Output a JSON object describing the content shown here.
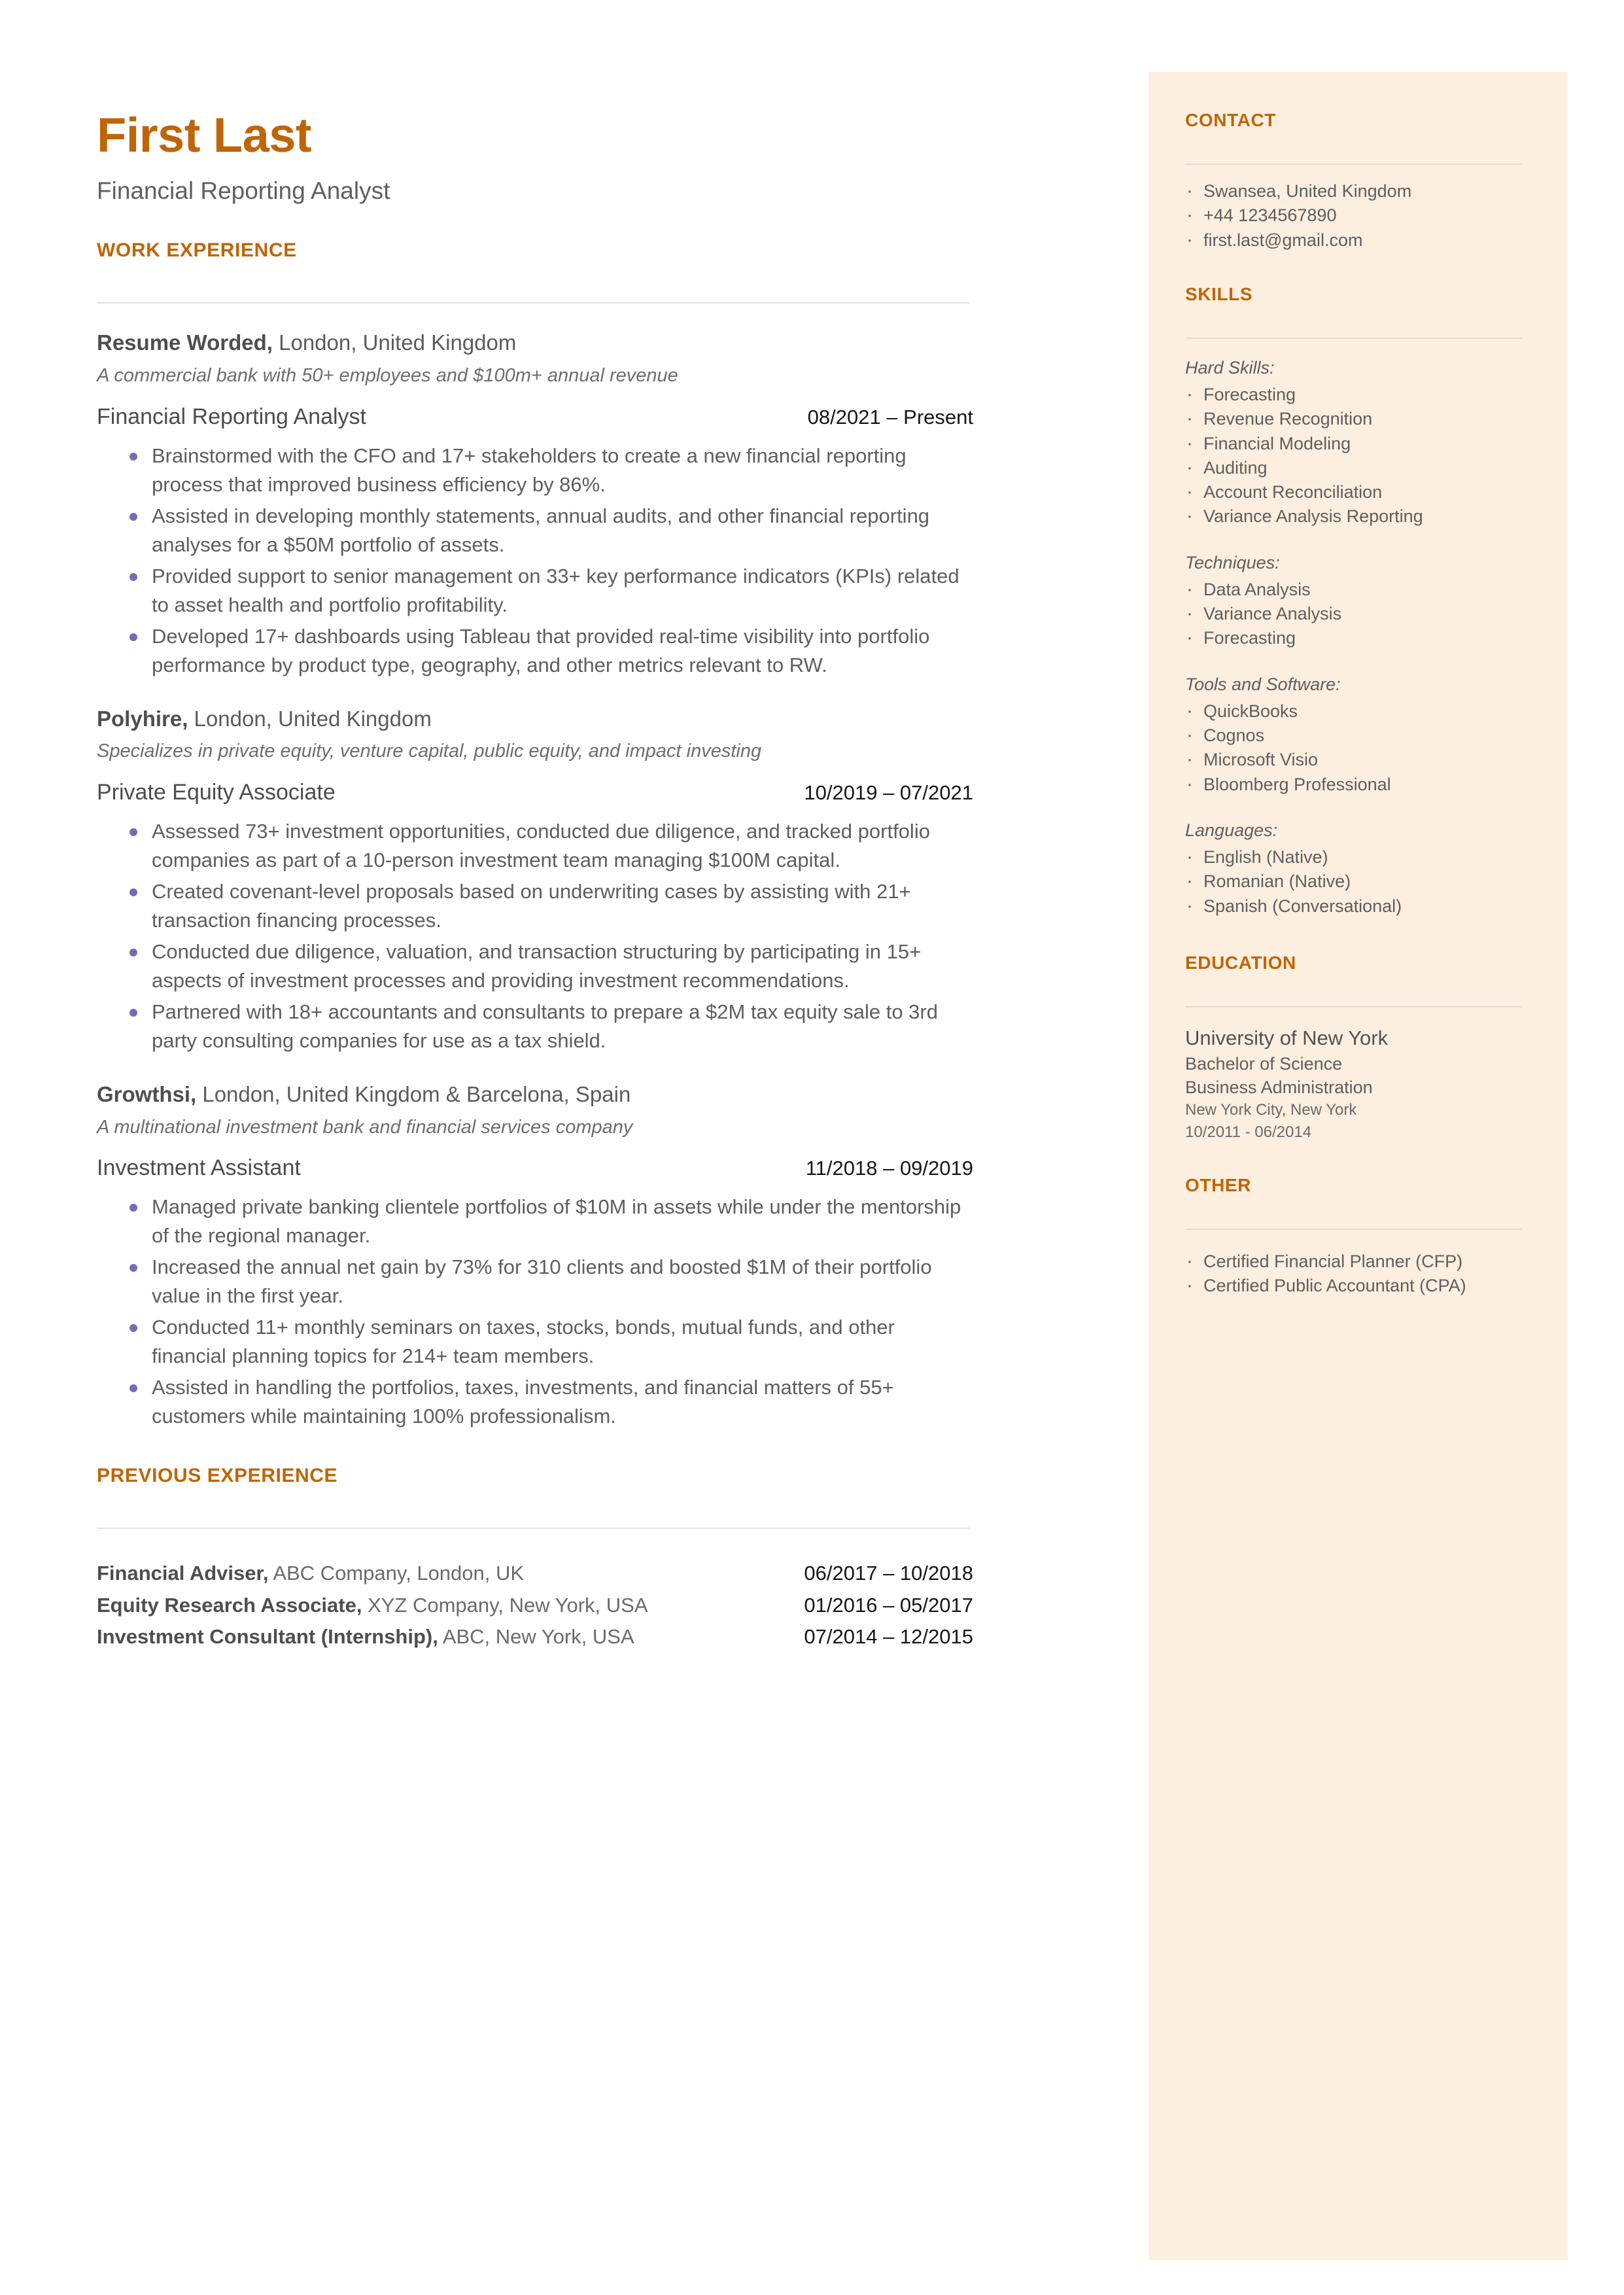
{
  "colors": {
    "accent": "#BF6507",
    "sidebar_bg": "#FDEFDF",
    "bullet": "#7B68B5",
    "body_text": "#5E5E5E",
    "date_text": "#161616"
  },
  "header": {
    "name": "First Last",
    "title": "Financial Reporting Analyst"
  },
  "work_experience": {
    "section_title": "WORK EXPERIENCE",
    "jobs": [
      {
        "company": "Resume Worded,",
        "location": " London, United Kingdom",
        "description": "A commercial bank with 50+ employees and $100m+ annual revenue",
        "role": "Financial Reporting Analyst",
        "dates": "08/2021 – Present",
        "bullets": [
          "Brainstormed with the CFO and 17+ stakeholders to create a new financial reporting process that improved business efficiency by 86%.",
          "Assisted in developing monthly statements, annual audits, and other financial reporting analyses for a $50M portfolio of assets.",
          "Provided support to senior management on 33+ key performance indicators (KPIs) related to asset health and portfolio profitability.",
          "Developed 17+ dashboards using Tableau that provided real-time visibility into portfolio performance by product type, geography, and other metrics relevant to RW."
        ]
      },
      {
        "company": "Polyhire,",
        "location": " London, United Kingdom",
        "description": "Specializes in private equity, venture capital, public equity, and impact investing",
        "role": "Private Equity Associate",
        "dates": "10/2019 – 07/2021",
        "bullets": [
          "Assessed 73+ investment opportunities, conducted due diligence, and tracked portfolio companies as part of a 10-person investment team managing $100M capital.",
          "Created covenant-level proposals based on underwriting cases by assisting with 21+ transaction financing processes.",
          "Conducted due diligence, valuation, and transaction structuring by participating in 15+ aspects of investment processes and providing investment recommendations.",
          "Partnered with 18+ accountants and consultants to prepare a $2M tax equity sale to 3rd party consulting companies for use as a tax shield."
        ]
      },
      {
        "company": "Growthsi,",
        "location": " London, United Kingdom & Barcelona, Spain",
        "description": "A multinational investment bank and financial services company",
        "role": "Investment Assistant",
        "dates": "11/2018 – 09/2019",
        "bullets": [
          "Managed private banking clientele portfolios of $10M in assets while under the mentorship of the regional manager.",
          "Increased the annual net gain by 73% for 310 clients and boosted $1M of their portfolio value in the first year.",
          "Conducted 11+ monthly seminars on taxes, stocks, bonds, mutual funds, and other financial planning topics for 214+ team members.",
          "Assisted in handling the portfolios, taxes, investments, and financial matters of 55+ customers while maintaining 100% professionalism."
        ]
      }
    ]
  },
  "previous_experience": {
    "section_title": "PREVIOUS EXPERIENCE",
    "rows": [
      {
        "role": "Financial Adviser,",
        "details": " ABC Company, London, UK",
        "dates": "06/2017 – 10/2018"
      },
      {
        "role": "Equity Research Associate,",
        "details": " XYZ Company, New York, USA",
        "dates": "01/2016 – 05/2017"
      },
      {
        "role": "Investment Consultant (Internship),",
        "details": " ABC, New York, USA",
        "dates": "07/2014 – 12/2015"
      }
    ]
  },
  "sidebar": {
    "contact": {
      "section_title": "CONTACT",
      "items": [
        "Swansea, United Kingdom",
        "+44 1234567890",
        "first.last@gmail.com"
      ]
    },
    "skills": {
      "section_title": "SKILLS",
      "groups": [
        {
          "label": "Hard Skills:",
          "items": [
            "Forecasting",
            "Revenue Recognition",
            "Financial Modeling",
            "Auditing",
            "Account Reconciliation",
            "Variance Analysis Reporting"
          ]
        },
        {
          "label": "Techniques:",
          "items": [
            "Data Analysis",
            "Variance Analysis",
            "Forecasting"
          ]
        },
        {
          "label": "Tools and Software:",
          "items": [
            "QuickBooks",
            "Cognos",
            "Microsoft Visio",
            "Bloomberg Professional"
          ]
        },
        {
          "label": "Languages:",
          "items": [
            "English (Native)",
            "Romanian (Native)",
            "Spanish (Conversational)"
          ]
        }
      ]
    },
    "education": {
      "section_title": "EDUCATION",
      "school": "University of New York",
      "degree": "Bachelor of Science",
      "major": "Business Administration",
      "location": "New York City, New York",
      "dates": "10/2011 - 06/2014"
    },
    "other": {
      "section_title": "OTHER",
      "items": [
        "Certified Financial Planner (CFP)",
        "Certified Public Accountant (CPA)"
      ]
    }
  }
}
